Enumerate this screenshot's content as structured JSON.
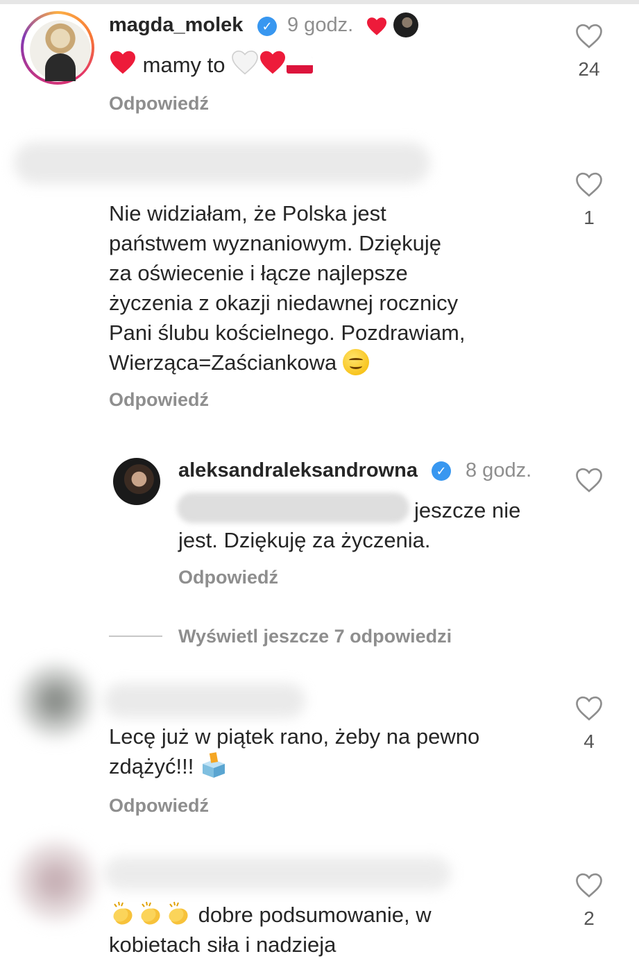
{
  "comments": [
    {
      "username": "magda_molek",
      "verified": true,
      "time": "9 godz.",
      "text": "mamy to",
      "reply_label": "Odpowiedź",
      "likes": "24"
    },
    {
      "username": "",
      "text_lines": [
        "Nie widziałam, że Polska jest",
        "państwem wyznaniowym. Dziękuję",
        "za oświecenie i łącze najlepsze",
        "życzenia z okazji niedawnej rocznicy",
        "Pani ślubu kościelnego. Pozdrawiam,",
        "Wierząca=Zaściankowa"
      ],
      "reply_label": "Odpowiedź",
      "likes": "1"
    },
    {
      "username": "",
      "text_lines": [
        "Lecę już w piątek rano, żeby na pewno",
        "zdążyć!!!"
      ],
      "reply_label": "Odpowiedź",
      "likes": "4"
    },
    {
      "username": "",
      "text_lines": [
        "dobre podsumowanie, w",
        "kobietach siła i nadzieja"
      ],
      "likes": "2"
    }
  ],
  "reply": {
    "username": "aleksandraleksandrowna",
    "verified": true,
    "time": "8 godz.",
    "text_line1": "jeszcze nie",
    "text_line2": "jest. Dziękuję za życzenia.",
    "reply_label": "Odpowiedź"
  },
  "view_more_replies": "Wyświetl jeszcze 7 odpowiedzi",
  "icons": {
    "like": "heart-outline-icon",
    "verified": "verified-badge-icon"
  },
  "colors": {
    "text": "#262626",
    "secondary": "#8e8e8e",
    "verified": "#3897f0",
    "heart_red": "#ed1b3a"
  }
}
